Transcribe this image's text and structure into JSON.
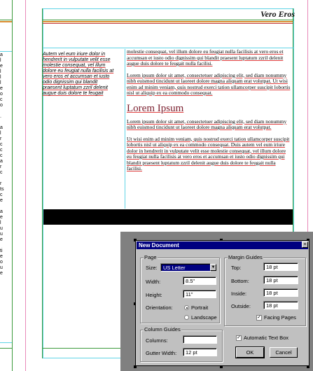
{
  "layout_page": {
    "running_head": "Vero Eros",
    "left_column_text": "Autem vel eum iriure dolor in hendrerit in vulputate velit esse molestie consequat, vel illum dolore eu feugiat nulla facilisis at vero eros et accumsan et iusto odio dignissim qui blandit praesent luptatum zzril delenit augue duis dolore te feugait",
    "body_paragraphs": [
      "molestie consequat, vel illum dolore eu feugiat nulla facilisis at vero eros et accumsan et iusto odio dignissim qui blandit praesent luptatum zzril delenit augue duis dolore te feugait nulla facilisi.",
      "Lorem ipsum dolor sit amet, consectetuer adipiscing elit, sed diam nonummy nibh euismod tincidunt ut laoreet dolore magna aliquam erat volutpat. Ut wisi enim ad minim veniam, quis nostrud exerci tation ullamcorper suscipit lobortis nisl ut aliquip ex ea commodo consequat."
    ],
    "heading": "Lorem Ipsum",
    "body_paragraphs_2": [
      "Lorem ipsum dolor sit amet, consectetuer adipiscing elit, sed diam nonummy nibh euismod tincidunt ut laoreet dolore magna aliquam erat volutpat.",
      "Ut wisi enim ad minim veniam, quis nostrud exerci tation ullamcorper suscipit lobortis nisl ut aliquip ex ea commodo consequat. Duis autem vel eum iriure dolor in hendrerit in vulputate velit esse molestie consequat, vel illum dolore eu feugiat nulla facilisis at vero eros et accumsan et iusto odio dignissim qui blandit praesent luptatum zzril delenit augue duis dolore te feugait nulla facilisi."
    ]
  },
  "dialog": {
    "title": "New Document",
    "close_glyph": "×",
    "page_group": {
      "label": "Page",
      "size_label": "Size:",
      "size_value": "US Letter",
      "width_label": "Width:",
      "width_value": "8.5\"",
      "height_label": "Height:",
      "height_value": "11\"",
      "orientation_label": "Orientation:",
      "portrait_label": "Portrait",
      "landscape_label": "Landscape",
      "orientation_selected": "Portrait"
    },
    "margin_group": {
      "label": "Margin Guides",
      "top_label": "Top:",
      "top_value": "18 pt",
      "bottom_label": "Bottom:",
      "bottom_value": "18 pt",
      "inside_label": "Inside:",
      "inside_value": "18 pt",
      "outside_label": "Outside:",
      "outside_value": "18 pt",
      "facing_pages_label": "Facing Pages",
      "facing_pages_checked": true
    },
    "column_group": {
      "label": "Column Guides",
      "columns_label": "Columns:",
      "columns_value": "",
      "gutter_label": "Gutter Width:",
      "gutter_value": "12 pt"
    },
    "auto_text_box_label": "Automatic Text Box",
    "auto_text_box_checked": true,
    "ok_label": "OK",
    "cancel_label": "Cancel"
  },
  "colors": {
    "titlebar": "#000080",
    "dialog_face": "#c0c0c0",
    "margin_guide": "#e889b8",
    "column_guide": "#5fd4e6",
    "heading": "#7a1f2e"
  }
}
